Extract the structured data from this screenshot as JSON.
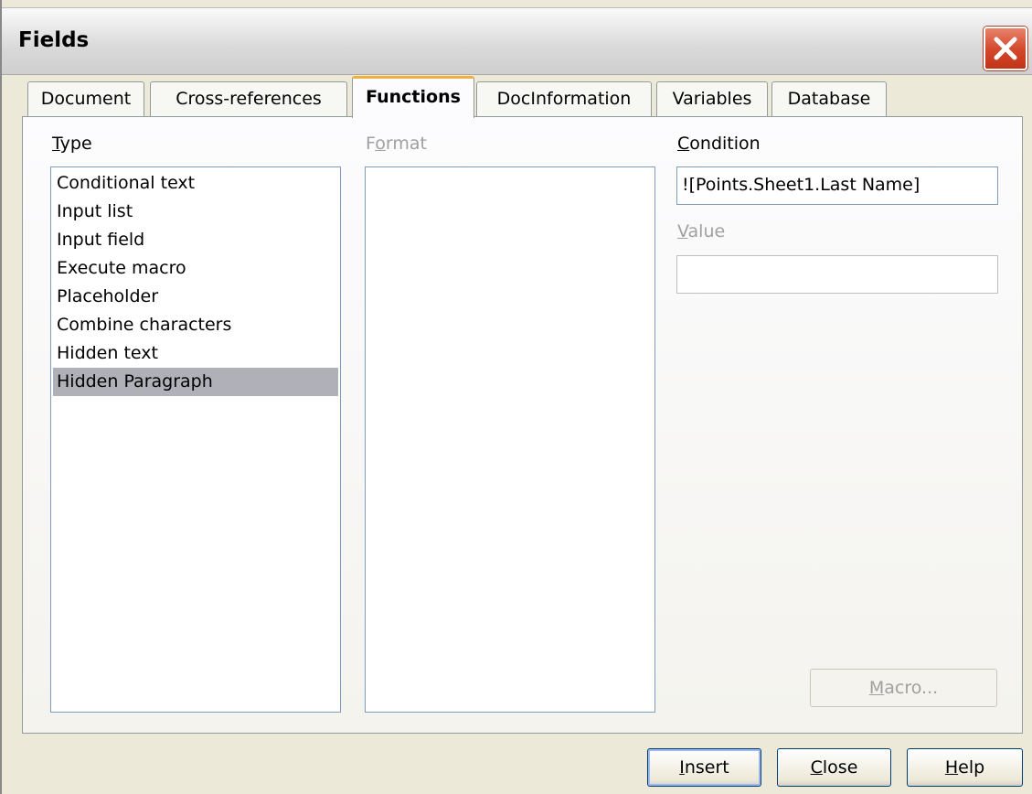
{
  "window": {
    "title": "Fields"
  },
  "tabs": [
    {
      "label": "Document"
    },
    {
      "label": "Cross-references"
    },
    {
      "label": "Functions",
      "active": true
    },
    {
      "label": "DocInformation"
    },
    {
      "label": "Variables"
    },
    {
      "label": "Database"
    }
  ],
  "type_section": {
    "label_first": "T",
    "label_rest": "ype",
    "items": [
      "Conditional text",
      "Input list",
      "Input field",
      "Execute macro",
      "Placeholder",
      "Combine characters",
      "Hidden text",
      "Hidden Paragraph"
    ],
    "selected": "Hidden Paragraph"
  },
  "format_section": {
    "label_first": "F",
    "label_mid": "o",
    "label_rest": "rmat"
  },
  "condition_section": {
    "label_first": "C",
    "label_rest": "ondition",
    "value": "![Points.Sheet1.Last Name]"
  },
  "value_section": {
    "label_first": "V",
    "label_rest": "alue",
    "value": ""
  },
  "buttons": {
    "macro_first": "M",
    "macro_rest": "acro...",
    "insert_first": "I",
    "insert_rest": "nsert",
    "close_first": "C",
    "close_rest": "lose",
    "help_first": "H",
    "help_rest": "elp"
  },
  "colors": {
    "dialog_bg": "#ece9d8",
    "selection": "#b0b0b8",
    "active_tab_accent": "#f0b040",
    "close_button": "#d2462a"
  }
}
